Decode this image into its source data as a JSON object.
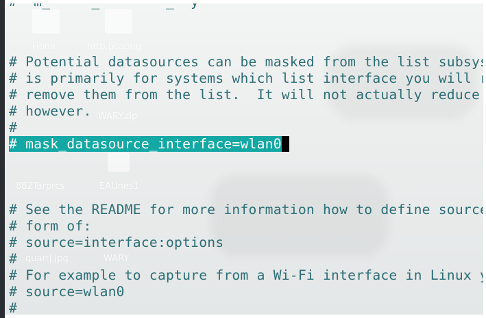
{
  "terminal": {
    "top_partial": "#  m_     _        _  y",
    "lines": [
      "# Potential datasources can be masked from the list subsystem",
      "# is primarily for systems which list interface you will run",
      "# remove them from the list.  It will not actually reduce CPU",
      "# however.",
      "#",
      "",
      "",
      "",
      "",
      "# See the README for more information how to define sources",
      "# form of:",
      "# source=interface:options",
      "#",
      "# For example to capture from a Wi-Fi interface in Linux you",
      "# source=wlan0",
      "#"
    ],
    "selected_line": "# mask_datasource_interface=wlan0"
  },
  "desktop": {
    "icons": [
      {
        "label": "Home"
      },
      {
        "label": "http.pcapng"
      },
      {
        "label": "WARY.zip"
      },
      {
        "label": "882Tarprcs"
      },
      {
        "label": "EAUnes1"
      },
      {
        "label": "quartj.jpg"
      },
      {
        "label": "WARY"
      }
    ]
  },
  "colors": {
    "text": "#2d6e76",
    "selection": "#13a8a4",
    "cursor": "#000000",
    "frame": "#2a2e33"
  }
}
